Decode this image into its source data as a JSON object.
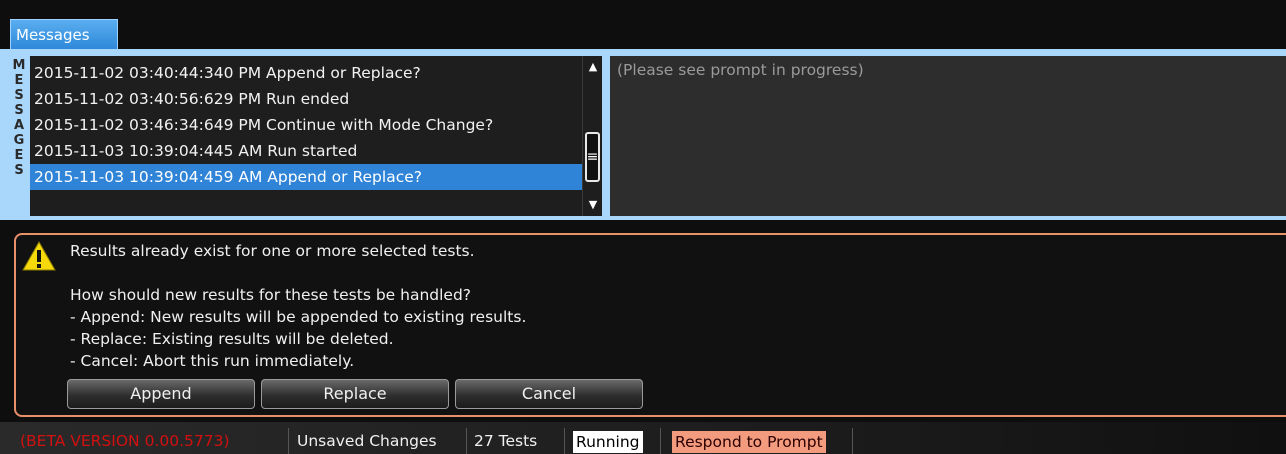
{
  "tabs": [
    {
      "label": "Messages",
      "active": true
    }
  ],
  "messages_panel": {
    "side_label": "MESSAGES",
    "items": [
      {
        "text": "2015-11-02 03:40:44:340 PM Append or Replace?",
        "selected": false
      },
      {
        "text": "2015-11-02 03:40:56:629 PM Run ended",
        "selected": false
      },
      {
        "text": "2015-11-02 03:46:34:649 PM Continue with Mode Change?",
        "selected": false
      },
      {
        "text": "2015-11-03 10:39:04:445 AM Run started",
        "selected": false
      },
      {
        "text": "2015-11-03 10:39:04:459 AM Append or Replace?",
        "selected": true
      }
    ],
    "detail_text": "(Please see prompt in progress)"
  },
  "prompt": {
    "icon": "warning-icon",
    "lines": [
      "Results already exist for one or more selected tests.",
      "How should new results for these tests be handled?",
      "- Append: New results will be appended to existing results.",
      "- Replace: Existing results will be deleted.",
      "- Cancel: Abort this run immediately."
    ],
    "buttons": {
      "append": "Append",
      "replace": "Replace",
      "cancel": "Cancel"
    }
  },
  "status_bar": {
    "version": "(BETA VERSION 0.00.5773)",
    "unsaved": "Unsaved Changes",
    "tests": "27 Tests",
    "state": "Running",
    "action": "Respond to Prompt"
  },
  "colors": {
    "accent": "#2f84d8",
    "panel_border": "#a9d6fb",
    "prompt_border": "#e8906a",
    "beta_text": "#d21010",
    "respond_bg": "#f39b7e"
  }
}
